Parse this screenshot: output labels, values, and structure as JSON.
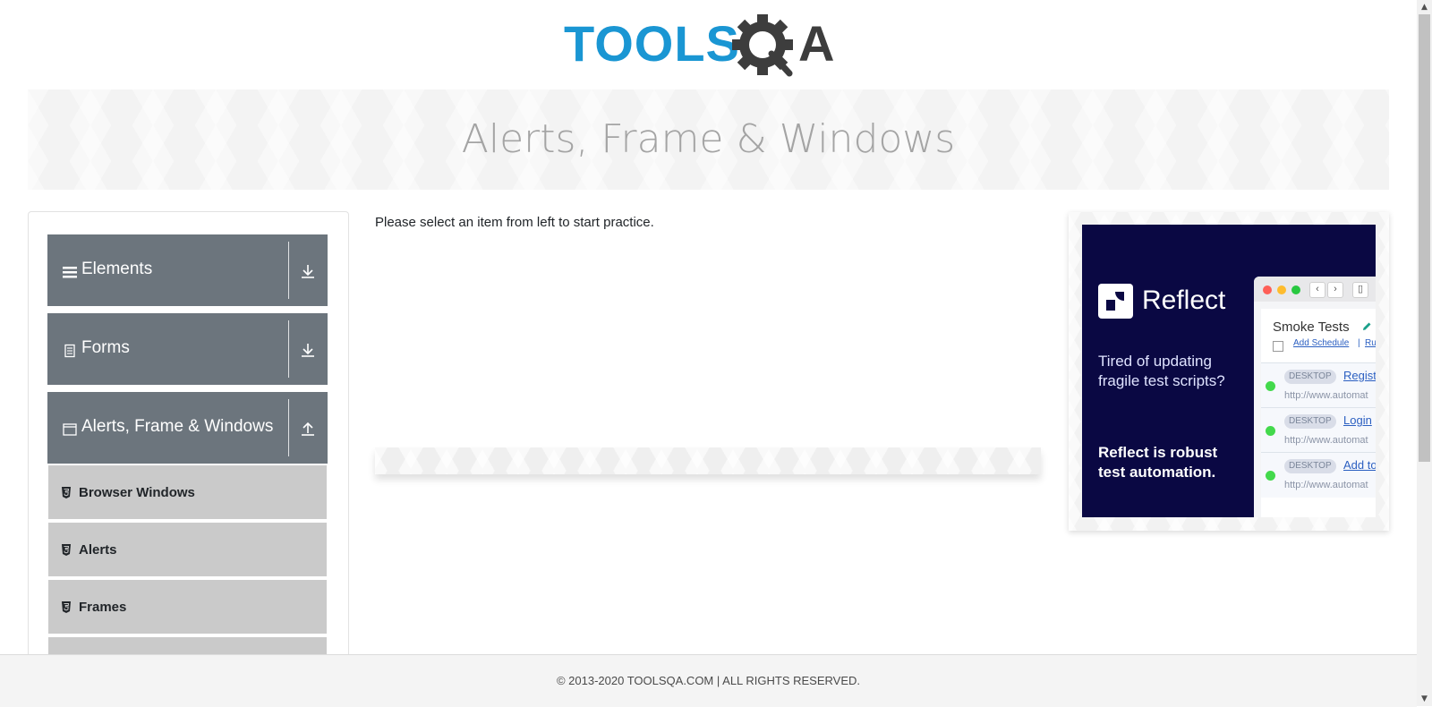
{
  "logo": {
    "text_main": "TOOLS",
    "text_end": "A",
    "colors": {
      "blue": "#1a96d3",
      "gray": "#3d3d3d"
    }
  },
  "banner": {
    "title": "Alerts, Frame & Windows"
  },
  "sidebar": {
    "groups": [
      {
        "label": "Elements",
        "icon": "hamburger-icon",
        "toggle_icon": "download-arrow-icon"
      },
      {
        "label": "Forms",
        "icon": "form-document-icon",
        "toggle_icon": "download-arrow-icon"
      },
      {
        "label": "Alerts, Frame & Windows",
        "icon": "window-icon",
        "toggle_icon": "upload-arrow-icon"
      }
    ],
    "items": [
      {
        "label": "Browser Windows",
        "icon": "html5-shield-icon"
      },
      {
        "label": "Alerts",
        "icon": "html5-shield-icon"
      },
      {
        "label": "Frames",
        "icon": "html5-shield-icon"
      }
    ]
  },
  "main": {
    "intro": "Please select an item from left to start practice."
  },
  "ad": {
    "brand": "Reflect",
    "tagline": "Tired of updating fragile test scripts?",
    "tagline2": "Reflect is robust test automation.",
    "panel_title": "Smoke Tests",
    "add_schedule": "Add Schedule",
    "pipe": "|",
    "run_fragment": "Ru",
    "rows": [
      {
        "badge": "DESKTOP",
        "name": "Registr",
        "url": "http://www.automat"
      },
      {
        "badge": "DESKTOP",
        "name": "Login",
        "url": "http://www.automat"
      },
      {
        "badge": "DESKTOP",
        "name": "Add to",
        "url": "http://www.automat"
      }
    ],
    "colors": {
      "background": "#0a0843",
      "link": "#2b5fc1",
      "status": "#43d94c"
    }
  },
  "footer": {
    "copyright": "© 2013-2020 TOOLSQA.COM | ALL RIGHTS RESERVED."
  }
}
